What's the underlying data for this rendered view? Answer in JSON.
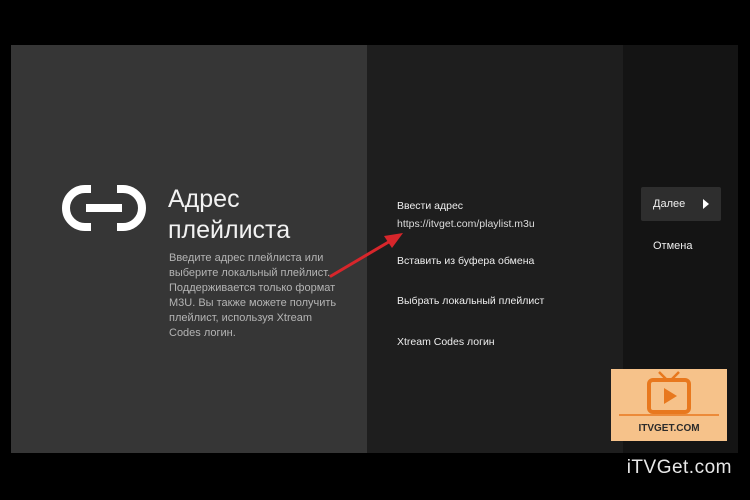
{
  "dialog": {
    "title": "Адрес плейлиста",
    "description": "Введите адрес плейлиста или выберите локальный плейлист. Поддерживается только формат M3U. Вы также можете получить плейлист, используя Xtream Codes логин.",
    "icon": "link-icon"
  },
  "options": [
    {
      "label": "Ввести адрес",
      "value": "https://itvget.com/playlist.m3u"
    },
    {
      "label": "Вставить из буфера обмена"
    },
    {
      "label": "Выбрать локальный плейлист"
    },
    {
      "label": "Xtream Codes логин"
    }
  ],
  "actions": {
    "next_label": "Далее",
    "cancel_label": "Отмена"
  },
  "watermark": {
    "text": "ITVGET.COM",
    "icon": "tv-play-icon",
    "colors": {
      "background": "#f6c28a",
      "accent": "#e8781e"
    }
  },
  "footer": {
    "brand": "iTVGet.com"
  },
  "colors": {
    "annotation_arrow": "#d7262b"
  }
}
